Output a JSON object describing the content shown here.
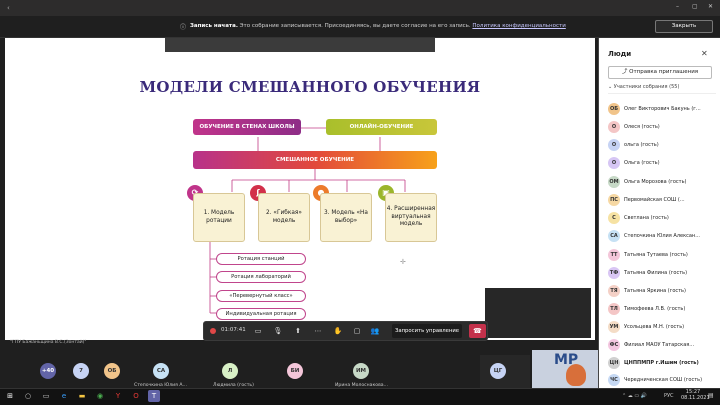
{
  "banner": {
    "bold": "Запись начата.",
    "text": "Это собрание записывается. Присоединяясь, вы даете согласие на его запись.",
    "link": "Политика конфиденциальности",
    "close": "Закрыть"
  },
  "slide": {
    "title": "МОДЕЛИ СМЕШАННОГО ОБУЧЕНИЯ",
    "bar_school": "ОБУЧЕНИЕ В СТЕНАХ ШКОЛЫ",
    "bar_online": "ОНЛАЙН-ОБУЧЕНИЕ",
    "bar_mixed": "СМЕШАННОЕ ОБУЧЕНИЕ",
    "cards": [
      "1. Модель ротации",
      "2. «Гибкая» модель",
      "3. Модель «На выбор»",
      "4. Расширенная виртуальная модель"
    ],
    "pills": [
      "Ротация станций",
      "Ротация лабораторий",
      "«Перевернутый класс»",
      "Индивидуальная ротация"
    ],
    "watermark": "\"ГПУ Бажаньщина В.С.(Зонтай)\""
  },
  "controls": {
    "time": "01:07:41",
    "request": "Запросить управление"
  },
  "panel": {
    "title": "Люди",
    "invite": "Отправка приглашения",
    "attendees": "Участники собрания (55)",
    "people": [
      {
        "initials": "ОБ",
        "name": "Олег Викторович Бакунь (г...",
        "color": "#f1c48a"
      },
      {
        "initials": "О",
        "name": "Олеся (гость)",
        "color": "#f4c6c6"
      },
      {
        "initials": "О",
        "name": "ольга (гость)",
        "color": "#c6d3f4"
      },
      {
        "initials": "О",
        "name": "Ольга (гость)",
        "color": "#d6c6f4"
      },
      {
        "initials": "ОМ",
        "name": "Ольга Морозова (гость)",
        "color": "#c7d9c7"
      },
      {
        "initials": "ПС",
        "name": "Первомайская СОШ (...",
        "color": "#f6d8a3"
      },
      {
        "initials": "С",
        "name": "Светлана (гость)",
        "color": "#f6e2a3"
      },
      {
        "initials": "СА",
        "name": "Степочкина Юлия Алексан...",
        "color": "#c6e1f4"
      },
      {
        "initials": "ТТ",
        "name": "Татьяна Тутаева (гость)",
        "color": "#f4c6d9"
      },
      {
        "initials": "ТФ",
        "name": "Татьяна Филина (гость)",
        "color": "#d9c6f4"
      },
      {
        "initials": "ТЯ",
        "name": "Татьяна Яркина (гость)",
        "color": "#f4d0c6"
      },
      {
        "initials": "ТЛ",
        "name": "Тимофеева Л.В. (гость)",
        "color": "#f4c6c6"
      },
      {
        "initials": "УМ",
        "name": "Усольцева М.Н. (гость)",
        "color": "#f4dcc6"
      },
      {
        "initials": "ФС",
        "name": "Филиал МАОУ Татарская...",
        "color": "#f4c6e0"
      },
      {
        "initials": "ЦН",
        "name": "ЦНППМПР г.Ишим (гость)",
        "color": "#d0d0d0"
      },
      {
        "initials": "ЧС",
        "name": "Чередниченская СОШ (гость)",
        "color": "#c6d9f4"
      }
    ]
  },
  "thumbs": [
    {
      "initials": "+40",
      "name": "",
      "color": "#6264a7"
    },
    {
      "initials": "7",
      "name": "",
      "color": "#c6d3f4"
    },
    {
      "initials": "ОБ",
      "name": "",
      "color": "#f1c48a"
    },
    {
      "initials": "СА",
      "name": "Степочкина Юлия А...",
      "color": "#c6e1f4"
    },
    {
      "initials": "Л",
      "name": "Людмила (гость)",
      "color": "#d8f0c6"
    },
    {
      "initials": "БИ",
      "name": "",
      "color": "#f4c6d9"
    },
    {
      "initials": "ИМ",
      "name": "Ирина Молоснакова...",
      "color": "#c7d9c7"
    },
    {
      "initials": "ЦГ",
      "name": "",
      "color": "#c6d3f4"
    }
  ],
  "tray": {
    "lang": "РУС",
    "time": "15:27",
    "date": "08.11.2021"
  }
}
